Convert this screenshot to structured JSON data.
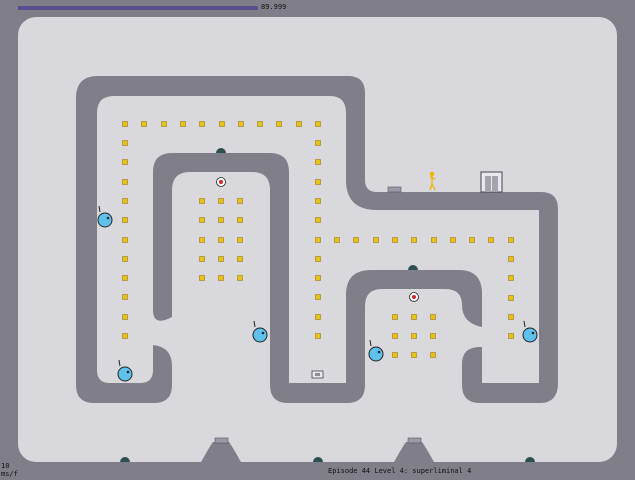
{
  "hud": {
    "timer_value": "89.999",
    "timer_fraction": 0.999,
    "level_name": "Episode 44 Level 4: superliminal 4",
    "fps_value": "10",
    "fps_unit": "ms/f"
  },
  "colors": {
    "wall": "#7f7e89",
    "floor": "#d9d9dd",
    "gold": "#e8c21a",
    "drone": "#5ec2ec",
    "mine": "#cc2a2a",
    "ninja": "#e8b800"
  },
  "level": {
    "ninja": "ninja",
    "exit_door": "exit-door",
    "drone_count": 5,
    "mine_count": 2
  }
}
